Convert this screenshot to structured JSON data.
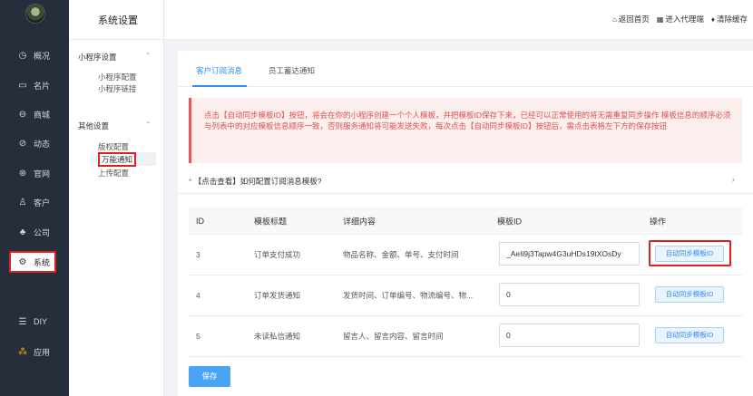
{
  "nav": {
    "items": [
      {
        "icon": "clock-icon",
        "glyph": "◷",
        "label": "概况"
      },
      {
        "icon": "card-icon",
        "glyph": "▭",
        "label": "名片"
      },
      {
        "icon": "bag-icon",
        "glyph": "⊖",
        "label": "商城"
      },
      {
        "icon": "compass-icon",
        "glyph": "⊘",
        "label": "动态"
      },
      {
        "icon": "globe-icon",
        "glyph": "⊛",
        "label": "官网"
      },
      {
        "icon": "person-icon",
        "glyph": "♙",
        "label": "客户"
      },
      {
        "icon": "org-icon",
        "glyph": "♣",
        "label": "公司"
      },
      {
        "icon": "gear-icon",
        "glyph": "⚙",
        "label": "系统"
      },
      {
        "icon": "diy-icon",
        "glyph": "☰",
        "label": "DIY"
      },
      {
        "icon": "apps-icon",
        "glyph": "⁂",
        "label": "应用"
      }
    ]
  },
  "sub": {
    "title": "系统设置",
    "group1": "小程序设置",
    "group1_links": [
      "小程序配置",
      "小程序链接"
    ],
    "group2": "其他设置",
    "group2_links": [
      "版权配置",
      "万能通知",
      "上传配置"
    ]
  },
  "top": {
    "home": "返回首页",
    "agent": "进入代理端",
    "clear": "清除缓存"
  },
  "tabs": [
    "客户订阅消息",
    "员工蓄达通知"
  ],
  "alert": "点击【自动同步模板ID】按钮，将会在你的小程序创建一个个人模板，并把模板ID保存下来，已经可以正常使用的将无需重复同步操作 模板信息的顺序必须与列表中的对应模板信息顺序一致，否则服务通知将可能发送失败，每次点击【自动同步模板ID】按钮后，需点击表格左下方的保存按钮",
  "collapse": {
    "label": "【点击查看】如何配置订阅消息模板?",
    "marker": "*"
  },
  "table": {
    "headers": [
      "ID",
      "模板标题",
      "详细内容",
      "模板ID",
      "操作"
    ],
    "rows": [
      {
        "id": "3",
        "title": "订单支付成功",
        "content": "物品名称、金额、单号、支付时间",
        "template_id": "_AeIi9j3Tapw4G3uHDs19tXOsDy",
        "action": "自动同步模板ID"
      },
      {
        "id": "4",
        "title": "订单发货通知",
        "content": "发货时间、订单编号、物流编号、物...",
        "template_id": "0",
        "action": "自动同步模板ID"
      },
      {
        "id": "5",
        "title": "未读私信通知",
        "content": "留言人、留言内容、留言时间",
        "template_id": "0",
        "action": "自动同步模板ID"
      }
    ]
  },
  "save_label": "保存"
}
